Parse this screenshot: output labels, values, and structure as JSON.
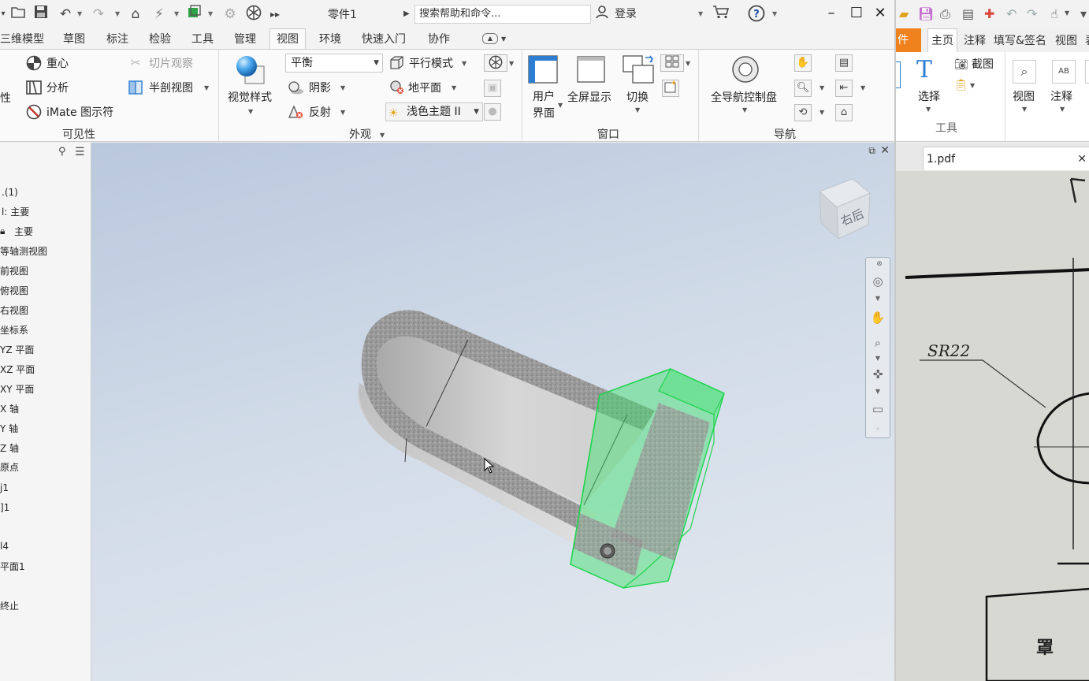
{
  "inventor": {
    "document_title": "零件1",
    "search_placeholder": "搜索帮助和命令...",
    "login_label": "登录",
    "tabs": [
      "三维模型",
      "草图",
      "标注",
      "检验",
      "工具",
      "管理",
      "视图",
      "环境",
      "快速入门",
      "协作"
    ],
    "active_tab": "视图",
    "ribbon": {
      "visibility": {
        "panel_label": "可见性",
        "partial_label": "性",
        "center_of_gravity": "重心",
        "analysis": "分析",
        "imate_glyph": "iMate 图示符",
        "slice_graphics": "切片观察",
        "half_section_view": "半剖视图"
      },
      "appearance": {
        "panel_label": "外观",
        "visual_style": "视觉样式",
        "visual_style_value": "平衡",
        "parallel_mode": "平行模式",
        "shadows": "阴影",
        "ground_plane": "地平面",
        "reflections": "反射",
        "light_theme": "浅色主题 II"
      },
      "window": {
        "panel_label": "窗口",
        "user_interface_line1": "用户",
        "user_interface_line2": "界面",
        "full_screen": "全屏显示",
        "switch": "切换"
      },
      "navigate": {
        "panel_label": "导航",
        "full_nav_wheel": "全导航控制盘"
      }
    },
    "browser": {
      "items": [
        ".(1)",
        "l:  主要",
        "主要",
        "等轴测视图",
        "前视图",
        "俯视图",
        "右视图",
        "坐标系",
        "YZ  平面",
        "XZ  平面",
        "XY  平面",
        "X  轴",
        "Y  轴",
        "Z  轴",
        "原点",
        "j1",
        "]1",
        "",
        "l4",
        "平面1",
        "",
        "终止"
      ]
    },
    "viewcube_label": "右后"
  },
  "pdf_reader": {
    "tabs": [
      "件",
      "主页",
      "注释",
      "填写&签名",
      "视图",
      "表"
    ],
    "active_tab": "主页",
    "tools": {
      "select": "选择",
      "screenshot": "截图",
      "view": "视图",
      "annotate": "注释",
      "group_label": "工具"
    },
    "file_tab": "1.pdf",
    "drawing_label": "SR22",
    "drawing_text_bottom": "罩"
  },
  "colors": {
    "accent_blue": "#2d7dd2",
    "selection_green": "#39e36a",
    "pdf_orange": "#f0821e",
    "viewport_top": "#bac8dd"
  }
}
